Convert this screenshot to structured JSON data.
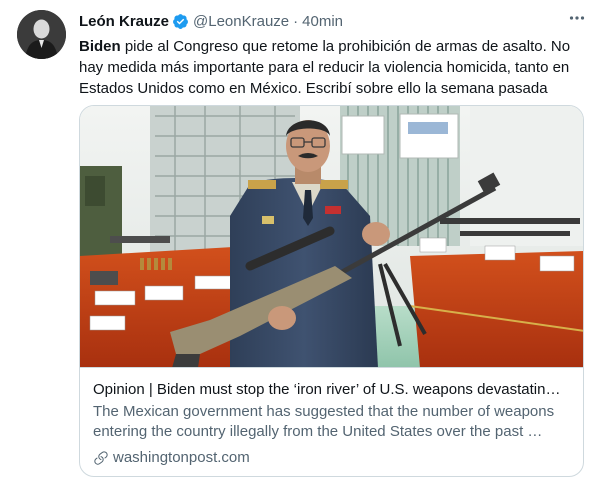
{
  "tweet": {
    "author_name": "León Krauze",
    "handle": "@LeonKrauze",
    "separator": "·",
    "time": "40min",
    "text_bold": "Biden",
    "text_rest": " pide al Congreso que retome la prohibición de armas de asalto. No hay medida más importante para el reducir la violencia homicida, tanto en Estados Unidos como en México. Escribí sobre ello la semana pasada",
    "verified_color": "#1d9bf0",
    "icons": [
      "verified-badge-icon",
      "more-options-icon",
      "link-icon"
    ]
  },
  "card": {
    "title": "Opinion | Biden must stop the ‘iron river’ of U.S. weapons devastatin…",
    "description": "The Mexican government has suggested that the number of weapons entering the country illegally from the United States over the past …",
    "domain": "washingtonpost.com"
  }
}
